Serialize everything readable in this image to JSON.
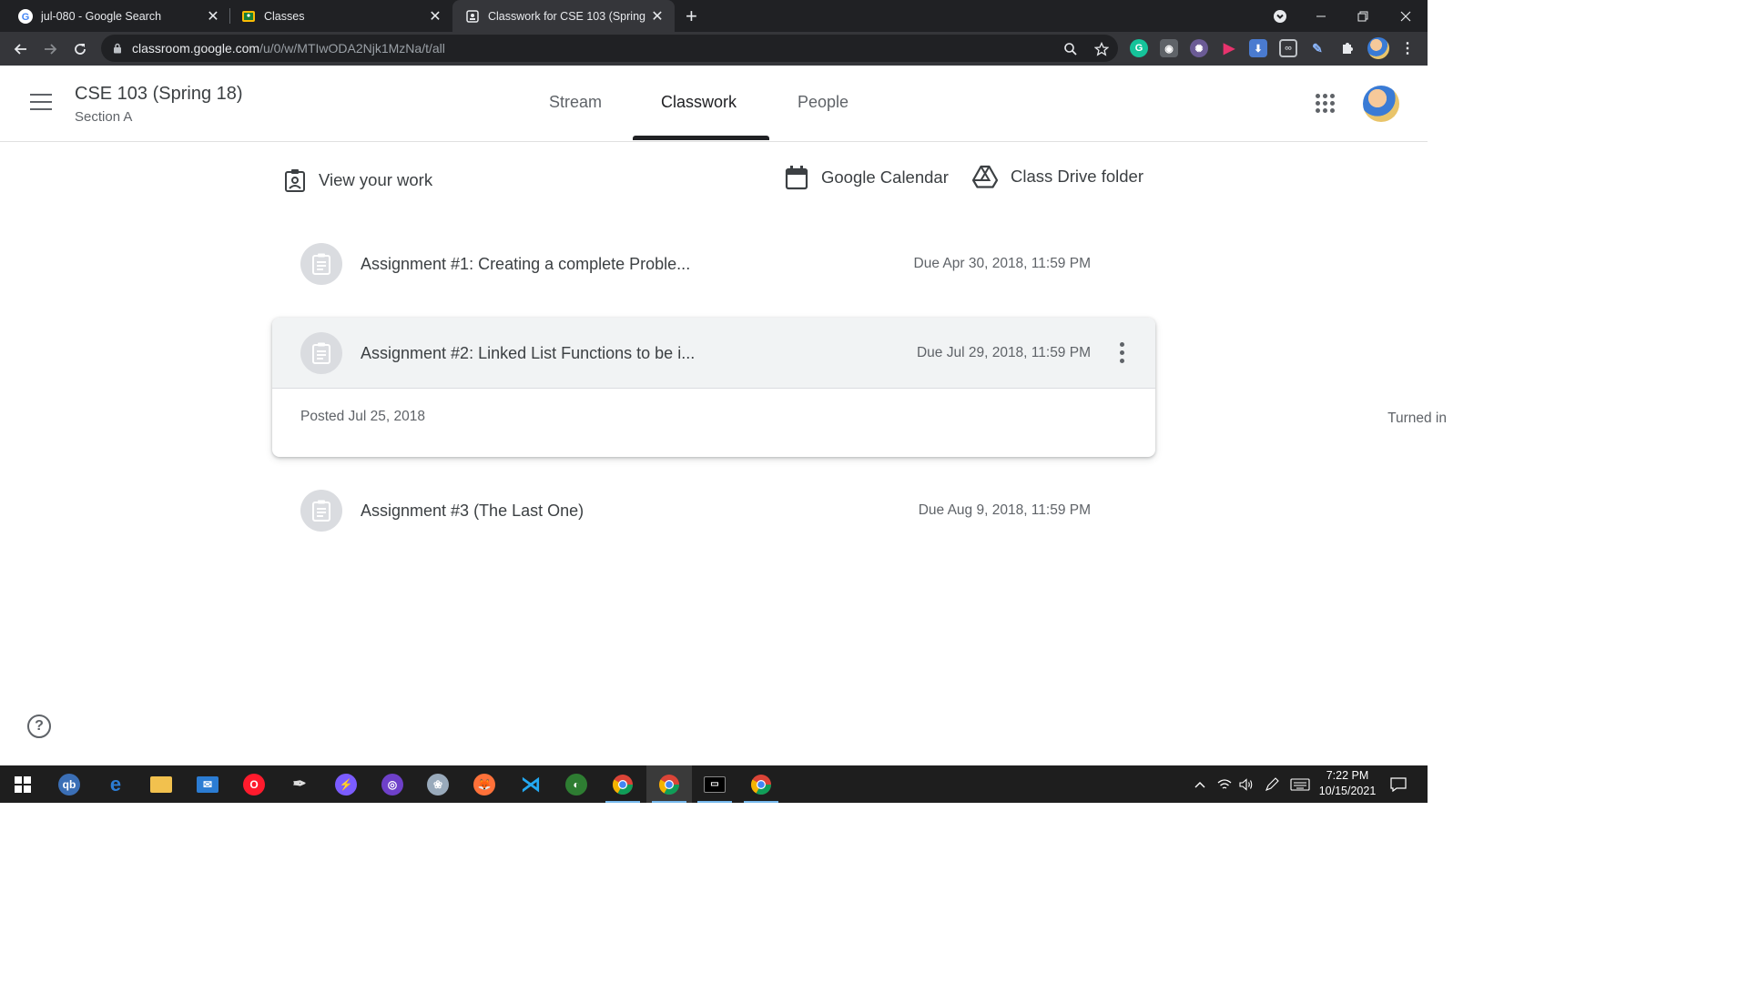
{
  "browser": {
    "tabs": [
      {
        "title": "jul-080 - Google Search",
        "favicon": "google-g-icon"
      },
      {
        "title": "Classes",
        "favicon": "classroom-icon"
      },
      {
        "title": "Classwork for CSE 103 (Spring 18",
        "favicon": "classwork-icon"
      }
    ],
    "url_host": "classroom.google.com",
    "url_path": "/u/0/w/MTIwODA2Njk1MzNa/t/all"
  },
  "header": {
    "class_name": "CSE 103 (Spring 18)",
    "section": "Section A",
    "tabs": [
      {
        "label": "Stream"
      },
      {
        "label": "Classwork"
      },
      {
        "label": "People"
      }
    ],
    "active_tab": "Classwork"
  },
  "toolbar": {
    "view_work": "View your work",
    "calendar": "Google Calendar",
    "drive": "Class Drive folder"
  },
  "assignments": [
    {
      "title": "Assignment #1: Creating a complete Proble...",
      "due": "Due Apr 30, 2018, 11:59 PM"
    },
    {
      "title": "Assignment #2: Linked List Functions to be i...",
      "due": "Due Jul 29, 2018, 11:59 PM",
      "posted": "Posted Jul 25, 2018",
      "status": "Turned in"
    },
    {
      "title": "Assignment #3 (The Last One)",
      "due": "Due Aug 9, 2018, 11:59 PM"
    }
  ],
  "help_symbol": "?",
  "taskbar": {
    "time": "7:22 PM",
    "date": "10/15/2021"
  },
  "colors": {
    "chrome_dark": "#202124",
    "chrome_toolbar": "#35363a",
    "expanded_card": "#f1f3f4",
    "text_primary": "#3c4043",
    "text_secondary": "#5f6368",
    "taskbar": "#1e1e1e"
  }
}
